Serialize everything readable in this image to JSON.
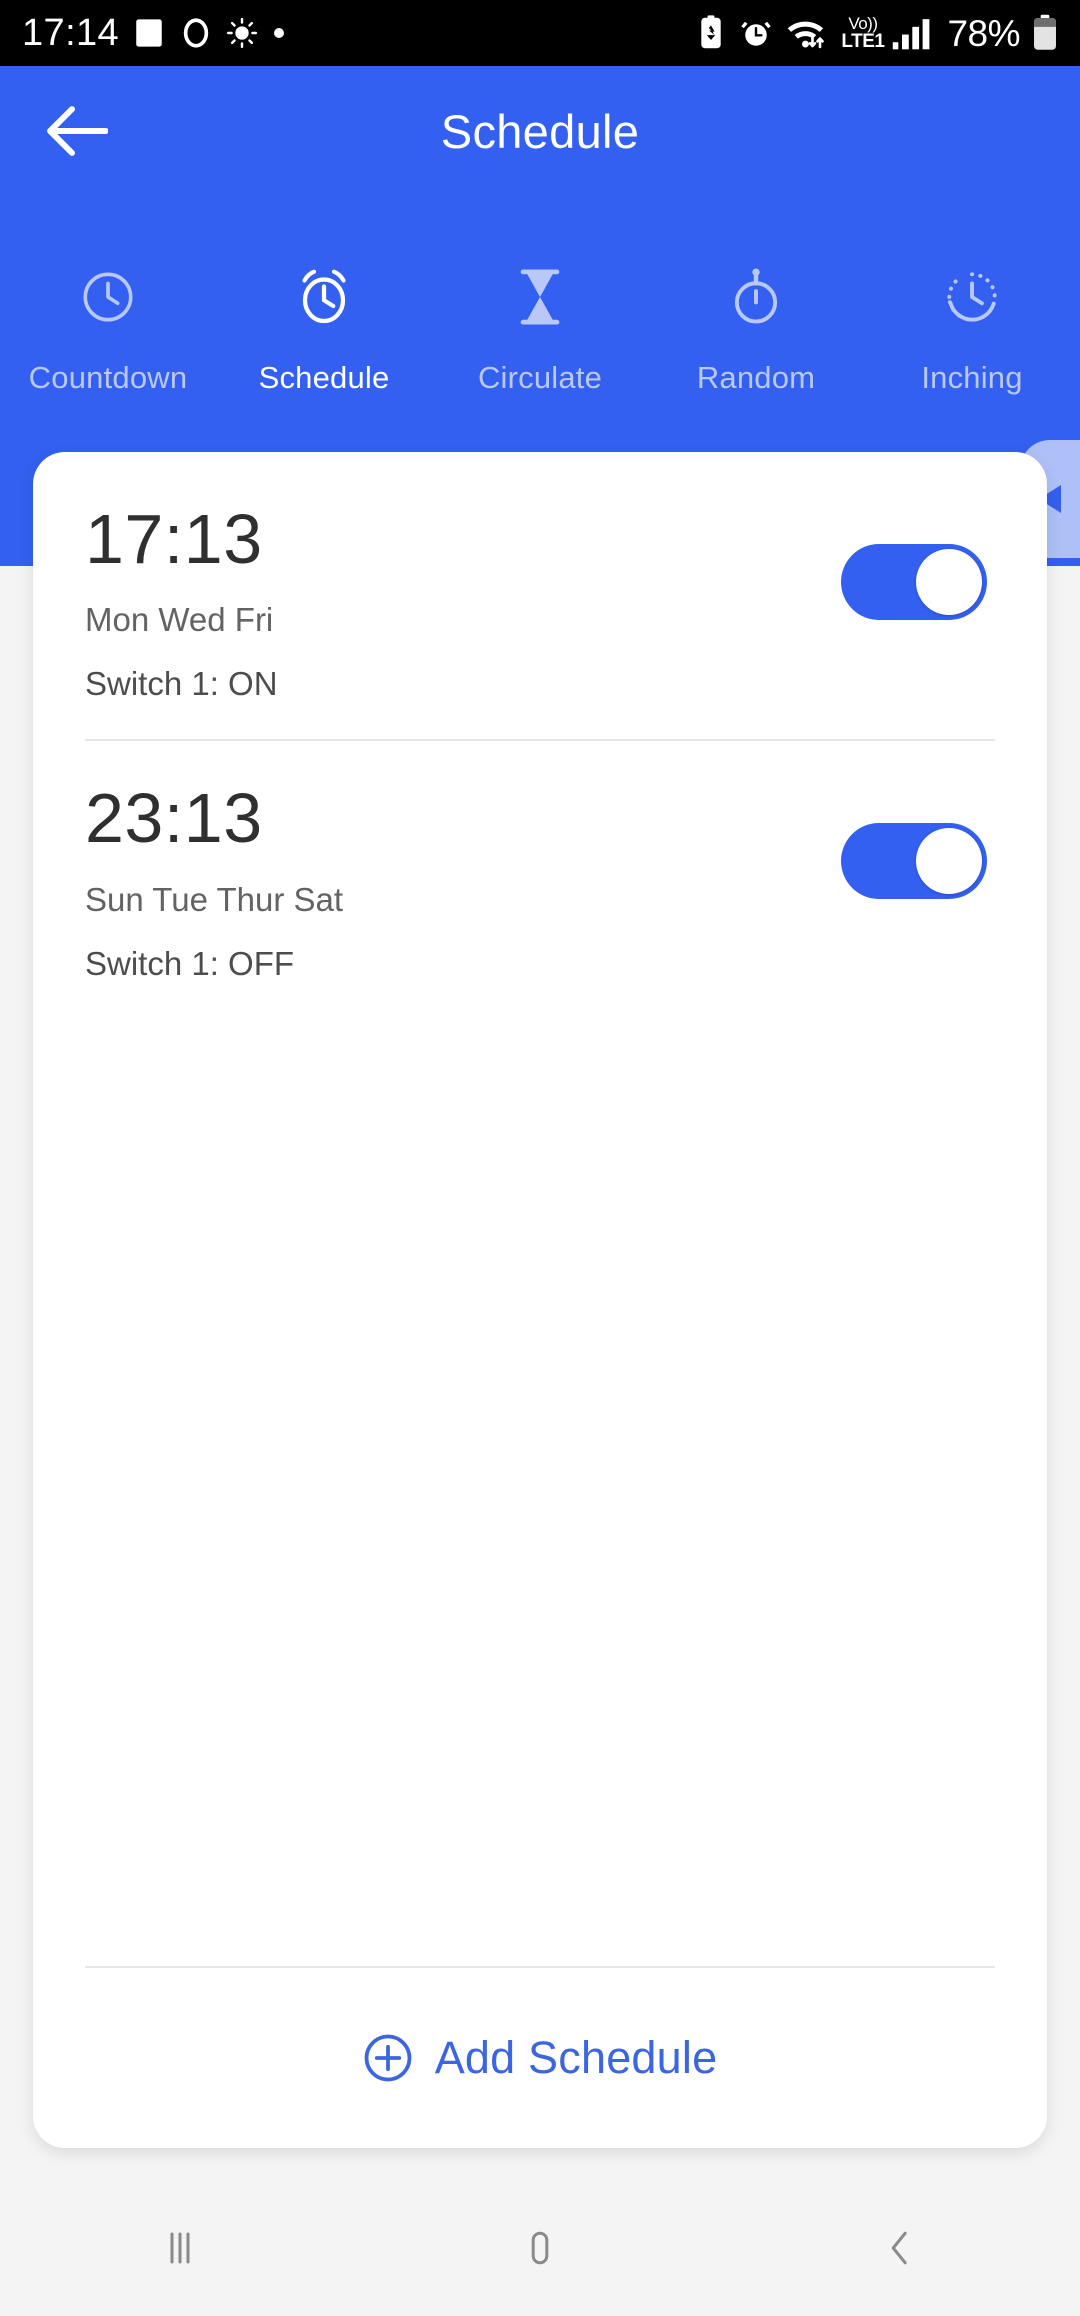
{
  "status_bar": {
    "time": "17:14",
    "left_icons": [
      "photo-icon",
      "circle-icon",
      "brightness-icon",
      "dot-icon"
    ],
    "right_icons": [
      "battery-saver-icon",
      "alarm-icon",
      "wifi-icon",
      "signal-bars-icon"
    ],
    "network_label_top": "Vo))",
    "network_label_bottom": "LTE1",
    "battery_percent": "78%"
  },
  "appbar": {
    "title": "Schedule",
    "back_icon": "arrow-left-icon",
    "bg_color": "#3360f0"
  },
  "tabs": [
    {
      "label": "Countdown",
      "icon": "clock-icon",
      "active": false
    },
    {
      "label": "Schedule",
      "icon": "alarm-clock-icon",
      "active": true
    },
    {
      "label": "Circulate",
      "icon": "hourglass-icon",
      "active": false
    },
    {
      "label": "Random",
      "icon": "stopwatch-icon",
      "active": false
    },
    {
      "label": "Inching",
      "icon": "dotted-clock-icon",
      "active": false
    }
  ],
  "drawer_tab": {
    "icon": "triangle-left-icon",
    "bg_color": "#aec0f7",
    "arrow_color": "#3360f0"
  },
  "schedules": [
    {
      "time": "17:13",
      "days": "Mon Wed Fri",
      "action": "Switch 1: ON",
      "enabled": true,
      "toggle_state": "on"
    },
    {
      "time": "23:13",
      "days": "Sun Tue Thur Sat",
      "action": "Switch 1: OFF",
      "enabled": true,
      "toggle_state": "on"
    }
  ],
  "add_schedule": {
    "label": "Add Schedule",
    "icon": "plus-circle-icon",
    "color": "#3b66e0"
  },
  "nav_bar": {
    "recents_icon": "recents-icon",
    "home_icon": "home-icon",
    "back_icon": "back-chevron-icon"
  },
  "colors": {
    "accent": "#3360f0",
    "card_bg": "#ffffff",
    "page_bg": "#f4f4f4",
    "tab_inactive": "#b9c8f7",
    "divider": "#e6e6e6"
  }
}
